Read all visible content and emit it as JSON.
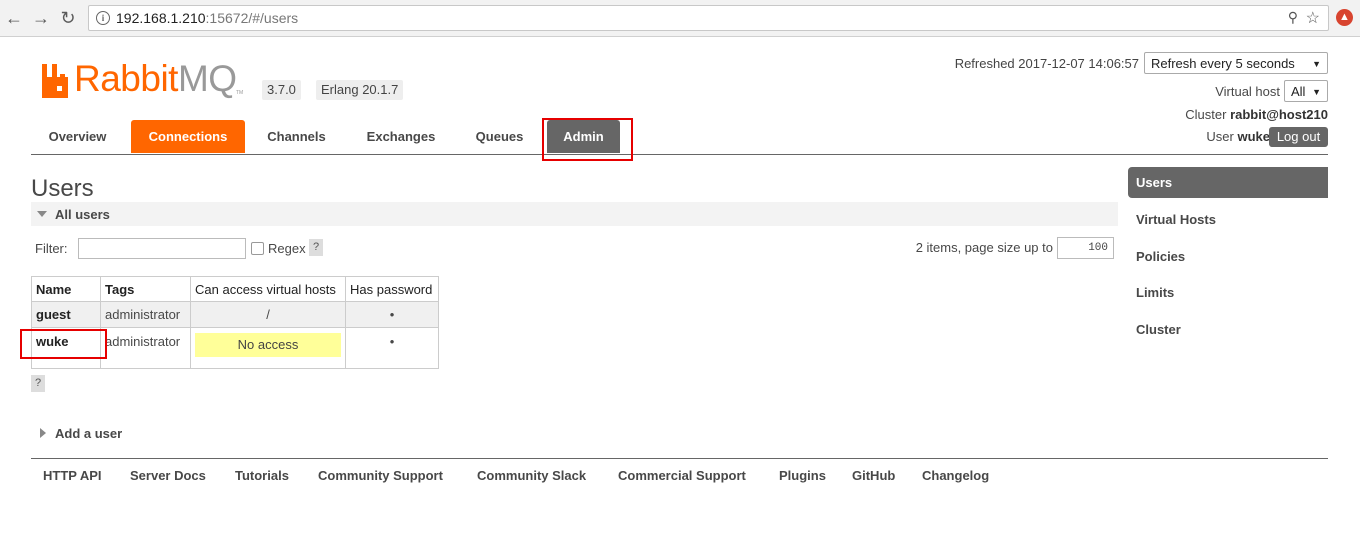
{
  "browser": {
    "url_host": "192.168.1.210",
    "url_rest": ":15672/#/users"
  },
  "header": {
    "logo_rabbit": "Rabbit",
    "logo_mq": "MQ",
    "logo_tm": "TM",
    "version": "3.7.0",
    "erlang": "Erlang 20.1.7",
    "refreshed": "Refreshed 2017-12-07 14:06:57",
    "refresh_select": "Refresh every 5 seconds",
    "vhost_label": "Virtual host",
    "vhost_select": "All",
    "cluster_label": "Cluster",
    "cluster_name": "rabbit@host210",
    "user_label": "User",
    "user_name": "wuke",
    "logout": "Log out"
  },
  "tabs": [
    "Overview",
    "Connections",
    "Channels",
    "Exchanges",
    "Queues",
    "Admin"
  ],
  "main": {
    "title": "Users",
    "section": "All users",
    "filter_label": "Filter:",
    "regex_label": "Regex",
    "help": "?",
    "items_text": "2 items, page size up to",
    "page_size": "100",
    "table": {
      "headers": [
        "Name",
        "Tags",
        "Can access virtual hosts",
        "Has password"
      ],
      "rows": [
        {
          "name": "guest",
          "tags": "administrator",
          "vhosts": "/",
          "password": "•"
        },
        {
          "name": "wuke",
          "tags": "administrator",
          "vhosts": "No access",
          "password": "•"
        }
      ]
    },
    "add_user": "Add a user"
  },
  "sidebar": [
    "Users",
    "Virtual Hosts",
    "Policies",
    "Limits",
    "Cluster"
  ],
  "footer": [
    "HTTP API",
    "Server Docs",
    "Tutorials",
    "Community Support",
    "Community Slack",
    "Commercial Support",
    "Plugins",
    "GitHub",
    "Changelog"
  ],
  "colors": {
    "brand": "#ff6600",
    "active_tab": "#666666",
    "highlight": "#e60000",
    "no_access": "#ffff99"
  }
}
